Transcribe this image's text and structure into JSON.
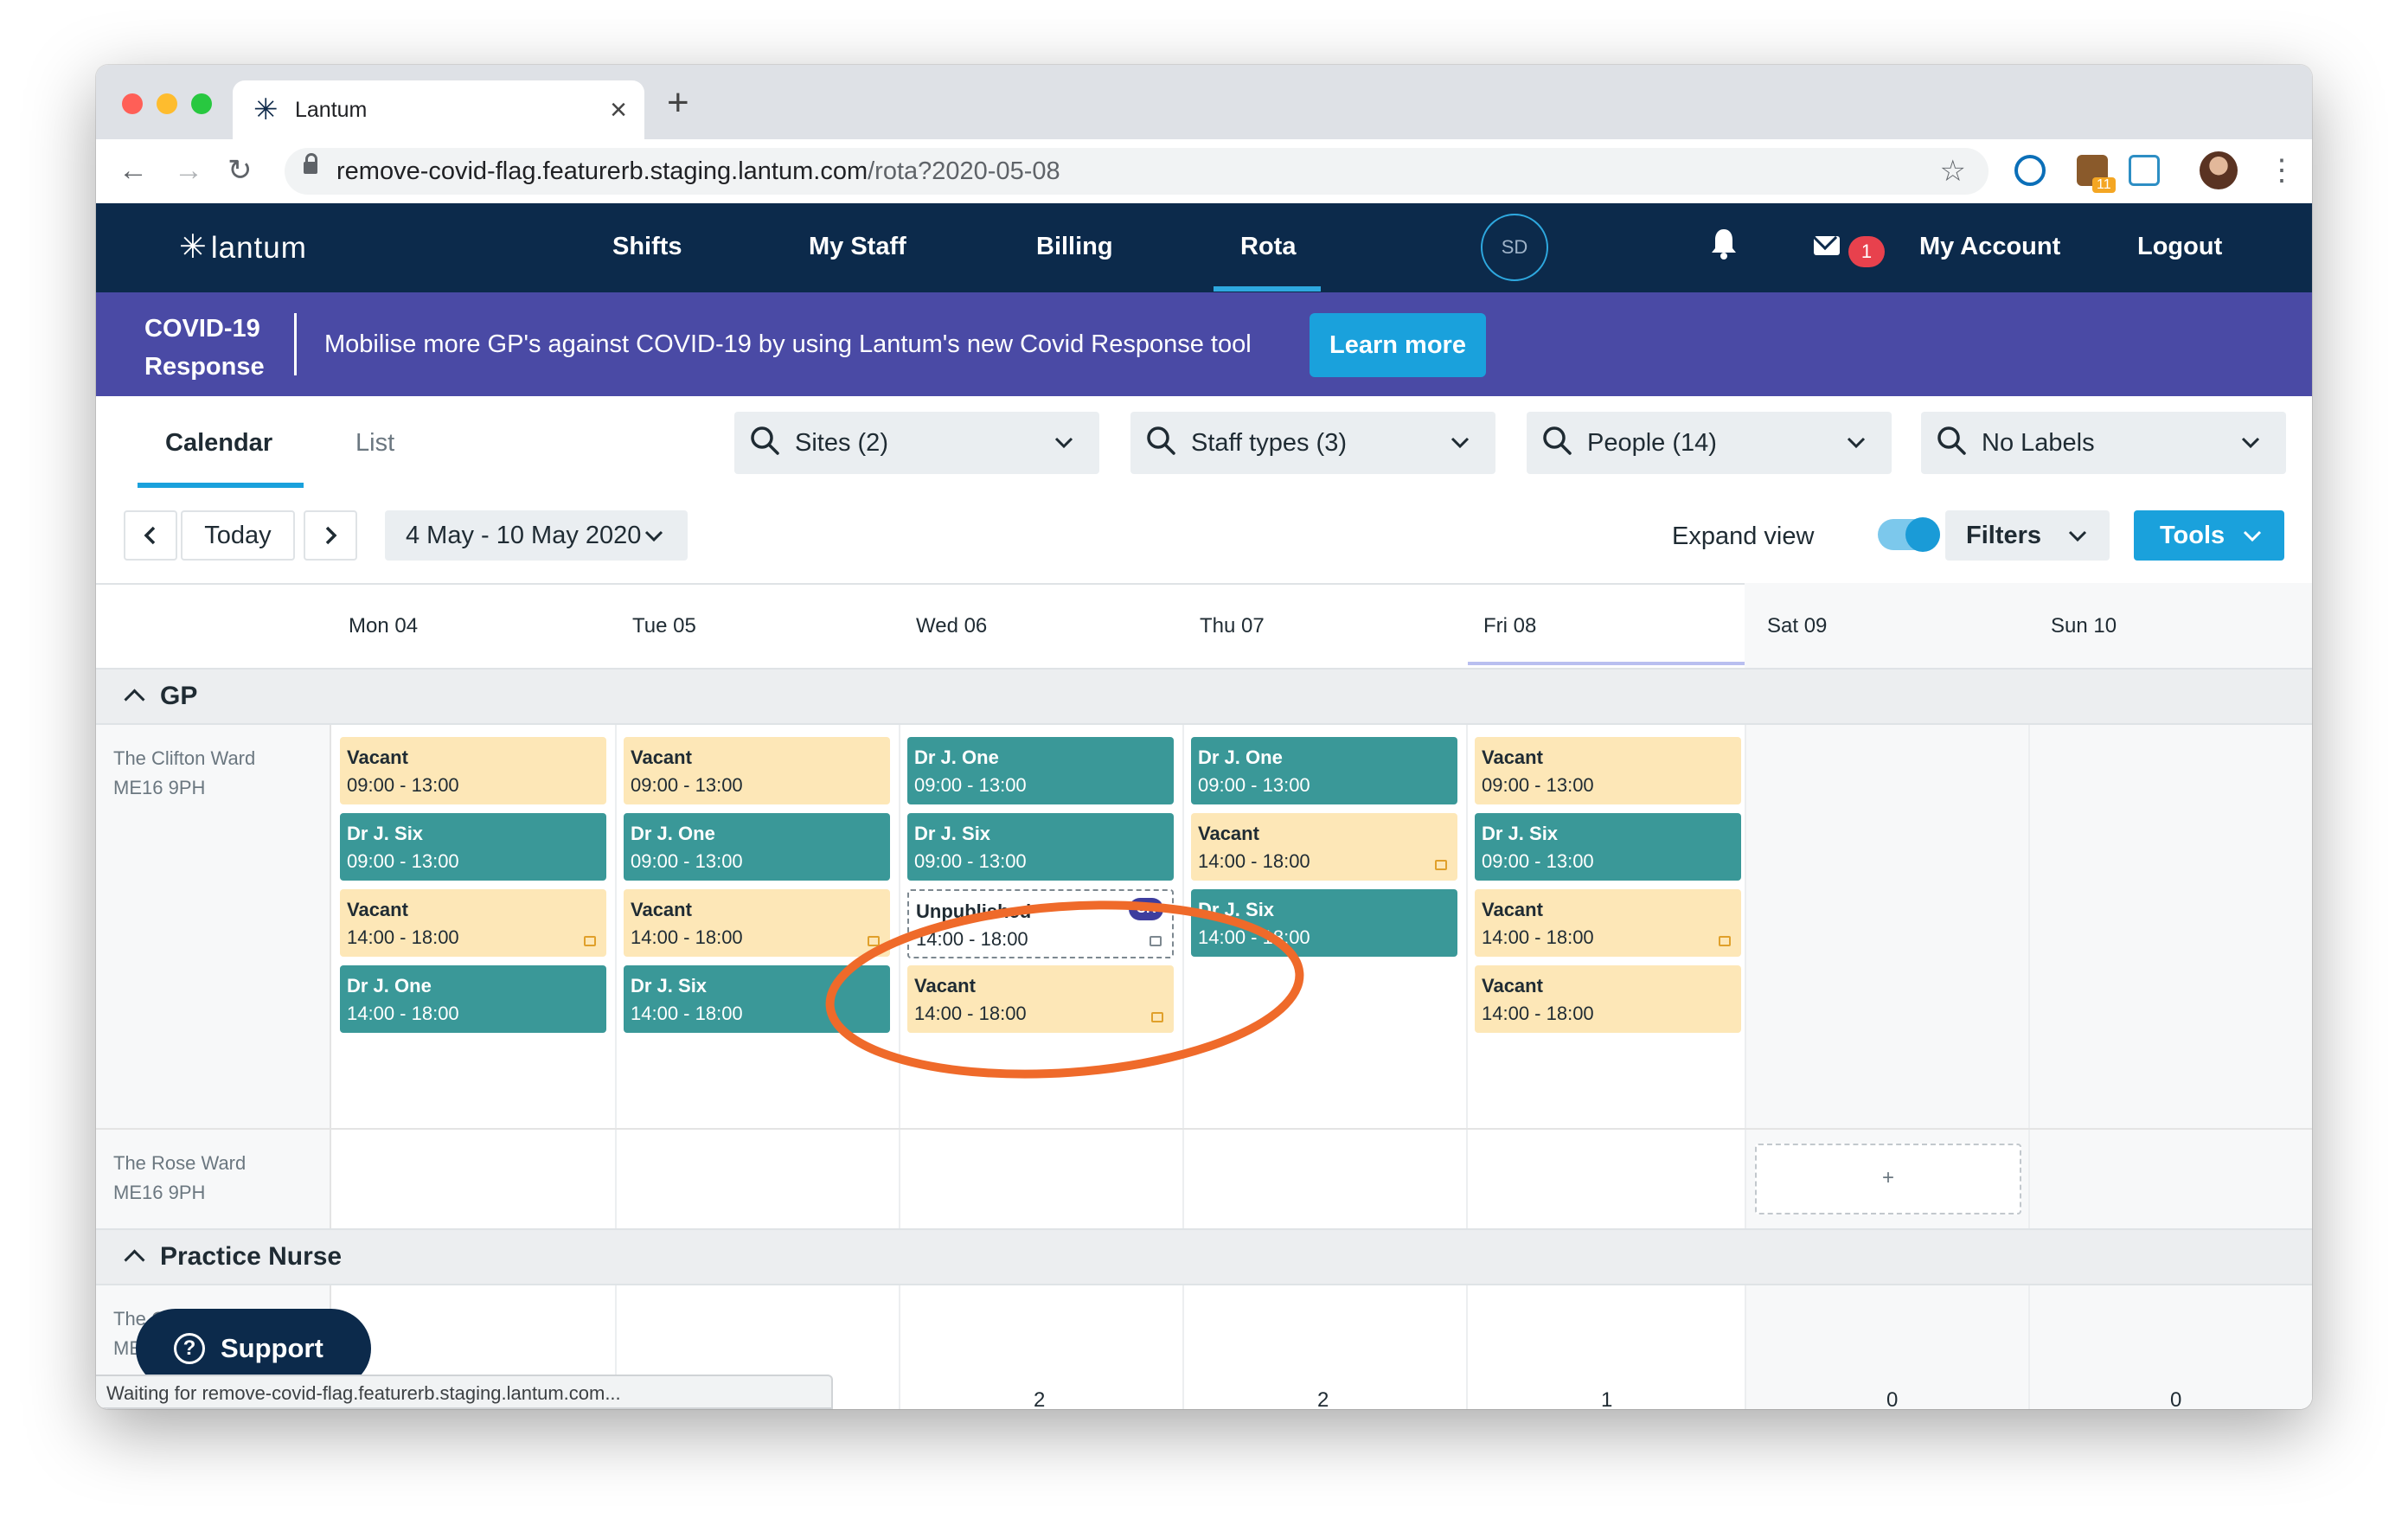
{
  "browser": {
    "tab_title": "Lantum",
    "url_host": "remove-covid-flag.featurerb.staging.lantum.com",
    "url_path": "/rota?2020-05-08",
    "extension_badge": "11",
    "status_text": "Waiting for remove-covid-flag.featurerb.staging.lantum.com..."
  },
  "header": {
    "logo": "lantum",
    "nav": [
      "Shifts",
      "My Staff",
      "Billing",
      "Rota"
    ],
    "active_nav": "Rota",
    "user_initials": "SD",
    "message_count": "1",
    "my_account": "My Account",
    "logout": "Logout"
  },
  "banner": {
    "title": "COVID-19 Response",
    "text": "Mobilise more GP's against COVID-19 by using Lantum's new Covid Response tool",
    "button": "Learn more"
  },
  "view_tabs": {
    "calendar": "Calendar",
    "list": "List",
    "active": "Calendar"
  },
  "filters": [
    "Sites (2)",
    "Staff types (3)",
    "People (14)",
    "No Labels"
  ],
  "controls": {
    "today": "Today",
    "date_range": "4 May - 10 May 2020",
    "expand_view": "Expand view",
    "expand_on": true,
    "filters_button": "Filters",
    "tools_button": "Tools"
  },
  "days": [
    "Mon 04",
    "Tue 05",
    "Wed 06",
    "Thu 07",
    "Fri 08",
    "Sat 09",
    "Sun 10"
  ],
  "sections": [
    {
      "title": "GP",
      "wards": [
        {
          "name": "The Clifton Ward",
          "postcode": "ME16 9PH"
        },
        {
          "name": "The Rose Ward",
          "postcode": "ME16 9PH"
        }
      ]
    },
    {
      "title": "Practice Nurse",
      "wards": [
        {
          "name": "The Clifton Ward",
          "postcode": "ME16 9PH"
        }
      ]
    }
  ],
  "shifts": {
    "mon": [
      {
        "name": "Vacant",
        "time": "09:00 - 13:00",
        "type": "vacant"
      },
      {
        "name": "Dr J. Six",
        "time": "09:00 - 13:00",
        "type": "staff"
      },
      {
        "name": "Vacant",
        "time": "14:00 - 18:00",
        "type": "vacant"
      },
      {
        "name": "Dr J. One",
        "time": "14:00 - 18:00",
        "type": "staff"
      }
    ],
    "tue": [
      {
        "name": "Vacant",
        "time": "09:00 - 13:00",
        "type": "vacant"
      },
      {
        "name": "Dr J. One",
        "time": "09:00 - 13:00",
        "type": "staff"
      },
      {
        "name": "Vacant",
        "time": "14:00 - 18:00",
        "type": "vacant"
      },
      {
        "name": "Dr J. Six",
        "time": "14:00 - 18:00",
        "type": "staff"
      }
    ],
    "wed": [
      {
        "name": "Dr J. One",
        "time": "09:00 - 13:00",
        "type": "staff"
      },
      {
        "name": "Dr J. Six",
        "time": "09:00 - 13:00",
        "type": "staff"
      },
      {
        "name": "Unpublished",
        "time": "14:00 - 18:00",
        "type": "unpublished",
        "badge": "CR"
      },
      {
        "name": "Vacant",
        "time": "14:00 - 18:00",
        "type": "vacant"
      }
    ],
    "thu": [
      {
        "name": "Dr J. One",
        "time": "09:00 - 13:00",
        "type": "staff"
      },
      {
        "name": "Vacant",
        "time": "14:00 - 18:00",
        "type": "vacant"
      },
      {
        "name": "Dr J. Six",
        "time": "14:00 - 18:00",
        "type": "staff"
      }
    ],
    "fri": [
      {
        "name": "Vacant",
        "time": "09:00 - 13:00",
        "type": "vacant"
      },
      {
        "name": "Dr J. Six",
        "time": "09:00 - 13:00",
        "type": "staff"
      },
      {
        "name": "Vacant",
        "time": "14:00 - 18:00",
        "type": "vacant"
      },
      {
        "name": "Vacant",
        "time": "14:00 - 18:00",
        "type": "vacant"
      }
    ]
  },
  "add_slot": "+",
  "support": "Support",
  "day_counts": [
    "2",
    "2",
    "1",
    "0",
    "0"
  ],
  "colors": {
    "header_navy": "#0c2a4b",
    "banner_purple": "#4a4aa5",
    "accent_blue": "#1aa1dc",
    "vacant": "#fde7b7",
    "staff": "#3a9898",
    "annotation": "#ef6a2a"
  }
}
